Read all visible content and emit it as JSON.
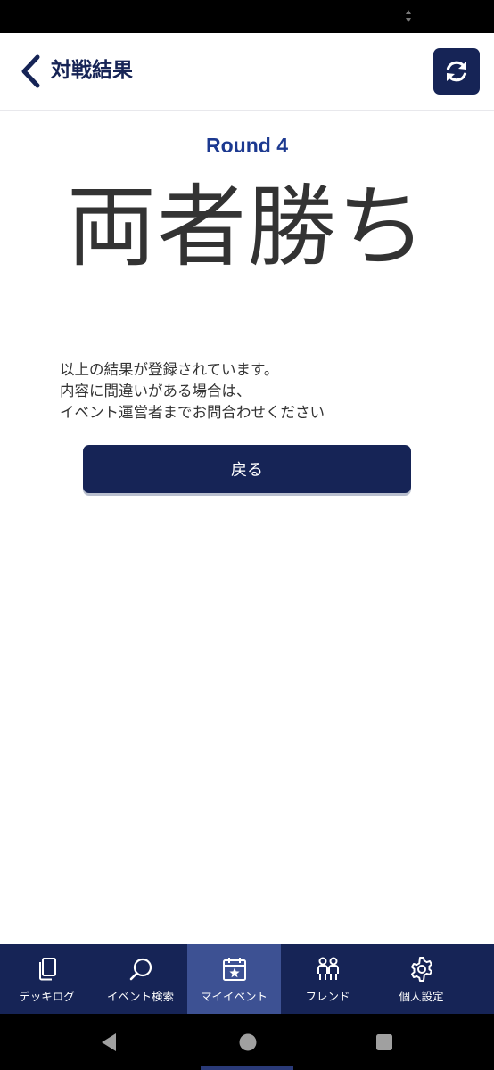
{
  "header": {
    "title": "対戦結果"
  },
  "result": {
    "round": "Round 4",
    "outcome": "両者勝ち",
    "message_lines": [
      "以上の結果が登録されています。",
      "内容に間違いがある場合は、",
      "イベント運営者までお問合わせください"
    ],
    "back_button_label": "戻る"
  },
  "bottom_nav": {
    "items": [
      {
        "label": "デッキログ",
        "icon": "deck-icon",
        "active": false
      },
      {
        "label": "イベント検索",
        "icon": "search-icon",
        "active": false
      },
      {
        "label": "マイイベント",
        "icon": "calendar-star-icon",
        "active": true
      },
      {
        "label": "フレンド",
        "icon": "friends-icon",
        "active": false
      },
      {
        "label": "個人設定",
        "icon": "gear-icon",
        "active": false
      }
    ]
  },
  "colors": {
    "navy": "#162456",
    "accent_blue": "#1c3990",
    "active_tab": "#3d5193",
    "text": "#333333"
  }
}
